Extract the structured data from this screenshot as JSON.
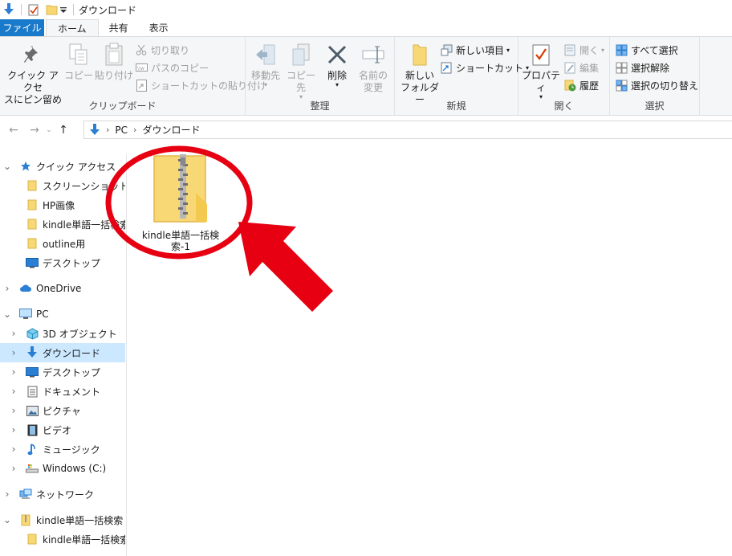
{
  "titlebar": {
    "title": "ダウンロード"
  },
  "tabs": [
    {
      "label": "ファイル"
    },
    {
      "label": "ホーム"
    },
    {
      "label": "共有"
    },
    {
      "label": "表示"
    }
  ],
  "ribbon": {
    "clipboard": {
      "label": "クリップボード",
      "pin_line1": "クイック アクセ",
      "pin_line2": "スにピン留め",
      "copy": "コピー",
      "paste": "貼り付け",
      "cut": "切り取り",
      "copy_path": "パスのコピー",
      "paste_shortcut": "ショートカットの貼り付け"
    },
    "organize": {
      "label": "整理",
      "move_to": "移動先",
      "copy_to": "コピー先",
      "delete": "削除",
      "rename_line1": "名前の",
      "rename_line2": "変更"
    },
    "new": {
      "label": "新規",
      "new_folder_line1": "新しい",
      "new_folder_line2": "フォルダー",
      "new_item": "新しい項目",
      "shortcut": "ショートカット"
    },
    "open": {
      "label": "開く",
      "properties": "プロパティ",
      "open": "開く",
      "edit": "編集",
      "history": "履歴"
    },
    "select": {
      "label": "選択",
      "select_all": "すべて選択",
      "select_none": "選択解除",
      "invert": "選択の切り替え"
    }
  },
  "address": {
    "crumbs": [
      "PC",
      "ダウンロード"
    ]
  },
  "navpane": {
    "quick_access": "クイック アクセス",
    "qa_items": [
      "スクリーンショット",
      "HP画像",
      "kindle単語一括検索",
      "outline用",
      "デスクトップ"
    ],
    "onedrive": "OneDrive",
    "pc": "PC",
    "pc_items": [
      "3D オブジェクト",
      "ダウンロード",
      "デスクトップ",
      "ドキュメント",
      "ピクチャ",
      "ビデオ",
      "ミュージック",
      "Windows (C:)"
    ],
    "network": "ネットワーク",
    "zip_root": "kindle単語一括検索",
    "zip_child": "kindle単語一括検索"
  },
  "content": {
    "zip_label": "kindle単語一括検索-1"
  },
  "colors": {
    "accent": "#1979ca",
    "selected": "#cce8ff",
    "highlight": "#e60012",
    "folder": "#f8d775"
  }
}
